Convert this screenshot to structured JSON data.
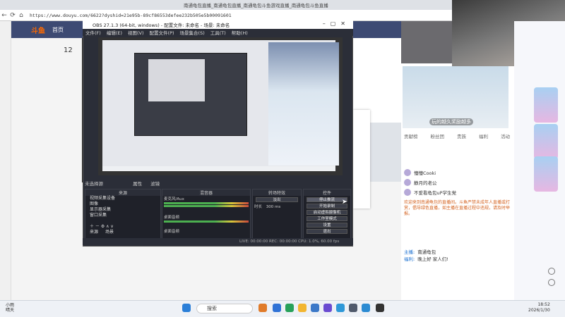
{
  "browser": {
    "url": "https://www.douyu.com/6622?dyshid=21e95b-89cf86553defee232b505e5b00091601",
    "tab_title": "南通龟包直播_南通龟包直播_南通龟包斗鱼游戏直播_南通龟包斗鱼直播"
  },
  "douyu": {
    "logo": "斗鱼",
    "home": "首页",
    "rank_number": "12"
  },
  "obs": {
    "title": "OBS 27.1.3 (64-bit, windows) - 配置文件: 未命名 - 场景: 未命名",
    "menu": [
      "文件(F)",
      "编辑(E)",
      "视图(V)",
      "配置文件(P)",
      "场景集合(S)",
      "工具(T)",
      "帮助(H)"
    ],
    "scene_label": "未选择源",
    "scene_tabs": [
      "属性",
      "滤镜"
    ],
    "docks": {
      "scenes_title": "来源",
      "mixer_title": "混音器",
      "transition_title": "转场特效",
      "controls_title": "控件"
    },
    "sources": [
      "视频采集设备",
      "图像",
      "显示器采集",
      "窗口采集"
    ],
    "bottom_tabs": [
      "来源",
      "场景"
    ],
    "mixer": [
      {
        "name": "麦克风/Aux",
        "level": "0.0 dB"
      },
      {
        "name": "桌面音频",
        "level": "0.0 dB"
      },
      {
        "name": "桌面音频",
        "level": "0.0 dB"
      }
    ],
    "transition": {
      "type": "淡出",
      "duration_label": "时长",
      "duration": "300 ms"
    },
    "controls": [
      "停止推流",
      "开始录制",
      "启动虚拟摄像机",
      "工作室模式",
      "设置",
      "退出"
    ],
    "status": "LIVE: 00:00:00   REC: 00:00:00   CPU: 1.0%, 60.00 fps"
  },
  "right_panel": {
    "tile_caption": "玩的越久奖励越多",
    "tabs": [
      "贡献榜",
      "粉丝团",
      "贵族",
      "福利",
      "活动"
    ],
    "rank_rows": [
      {
        "name": "懵懵Cooki"
      },
      {
        "name": "静月的老公"
      },
      {
        "name": "不爱看龟包uP学生党"
      }
    ],
    "warning": "欢迎来到南通龟包的直播间。斗鱼严禁未成年人直播或打赏，倡导绿色直播，如主播在直播过程中违规，请及时举报。",
    "chat": [
      {
        "user": "主播:",
        "text": "南通龟包"
      },
      {
        "user": "福利:",
        "text": "晚上好 家人们!"
      }
    ]
  },
  "taskbar": {
    "weather_line1": "小雨",
    "weather_line2": "晴天",
    "search": "搜索",
    "time": "18:52",
    "date": "2026/1/30"
  }
}
